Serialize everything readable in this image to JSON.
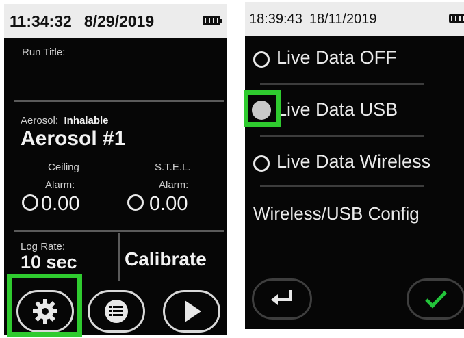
{
  "left_screen": {
    "status": {
      "time": "11:34:32",
      "date": "8/29/2019"
    },
    "run_title_label": "Run Title:",
    "aerosol": {
      "label": "Aerosol:",
      "type": "Inhalable",
      "name": "Aerosol #1"
    },
    "ceiling": {
      "label": "Ceiling",
      "alarm_label": "Alarm:",
      "value": "0.00"
    },
    "stel": {
      "label": "S.T.E.L.",
      "alarm_label": "Alarm:",
      "value": "0.00"
    },
    "log_rate": {
      "label": "Log Rate:",
      "value": "10 sec"
    },
    "calibrate_label": "Calibrate",
    "buttons": [
      "gear-icon",
      "list-icon",
      "play-icon"
    ]
  },
  "right_screen": {
    "status": {
      "time": "18:39:43",
      "date": "18/11/2019"
    },
    "options": [
      {
        "label": "Live Data OFF",
        "selected": false
      },
      {
        "label": "Live Data USB",
        "selected": true
      },
      {
        "label": "Live Data Wireless",
        "selected": false
      }
    ],
    "config_label": "Wireless/USB Config",
    "buttons": [
      "back-arrow-icon",
      "checkmark-icon"
    ]
  },
  "colors": {
    "highlight": "#2fcb2f",
    "confirm_check": "#22c43a",
    "screen_bg": "#060606"
  }
}
